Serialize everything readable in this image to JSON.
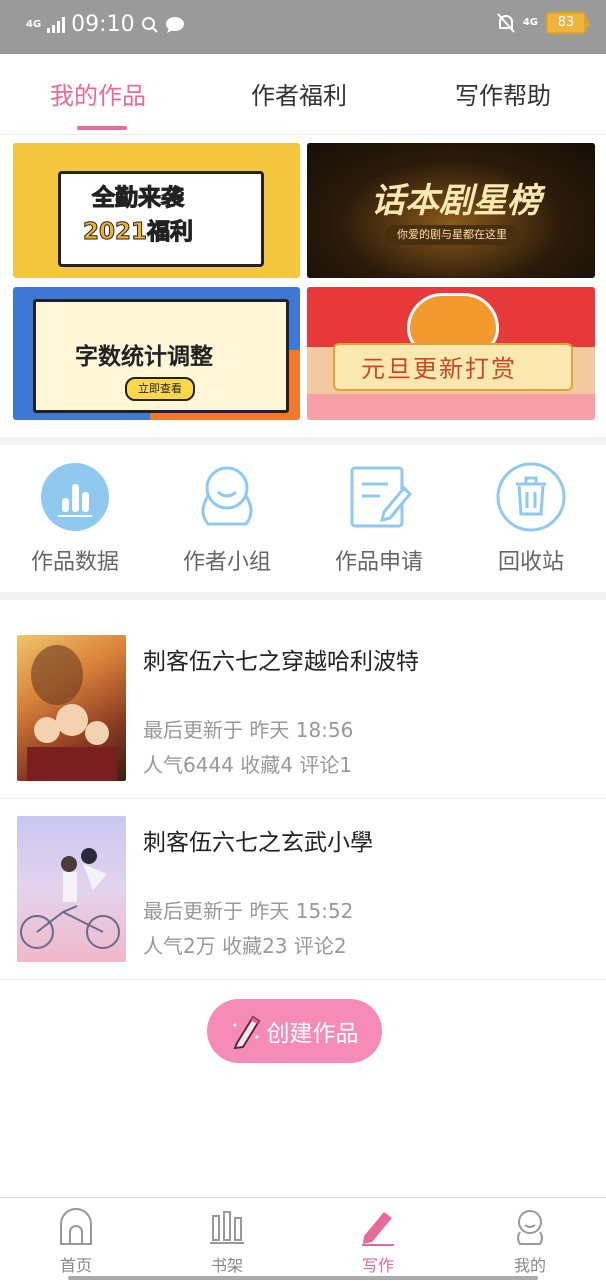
{
  "status": {
    "time": "09:10",
    "net_left": "4G",
    "net_right": "4G",
    "battery": "83"
  },
  "tabs": [
    {
      "label": "我的作品",
      "active": true
    },
    {
      "label": "作者福利",
      "active": false
    },
    {
      "label": "写作帮助",
      "active": false
    }
  ],
  "banners": {
    "b1": {
      "line1": "全勤来袭",
      "line2": "2021福利"
    },
    "b2": {
      "title": "话本剧星榜",
      "sub": "你爱的剧与星都在这里"
    },
    "b3": {
      "title": "字数统计调整",
      "button": "立即查看"
    },
    "b4": {
      "title": "元旦更新打赏"
    }
  },
  "shortcuts": [
    {
      "label": "作品数据",
      "icon": "bar-chart-icon"
    },
    {
      "label": "作者小组",
      "icon": "group-icon"
    },
    {
      "label": "作品申请",
      "icon": "edit-doc-icon"
    },
    {
      "label": "回收站",
      "icon": "trash-icon"
    }
  ],
  "works": [
    {
      "title": "刺客伍六七之穿越哈利波特",
      "updated": "最后更新于 昨天 18:56",
      "stats": "人气6444 收藏4 评论1"
    },
    {
      "title": "刺客伍六七之玄武小學",
      "updated": "最后更新于 昨天 15:52",
      "stats": "人气2万 收藏23 评论2"
    }
  ],
  "create_label": "创建作品",
  "nav": [
    {
      "label": "首页",
      "active": false
    },
    {
      "label": "书架",
      "active": false
    },
    {
      "label": "写作",
      "active": true
    },
    {
      "label": "我的",
      "active": false
    }
  ],
  "colors": {
    "accent": "#e86a9a",
    "icon_blue": "#8fc9ef"
  }
}
